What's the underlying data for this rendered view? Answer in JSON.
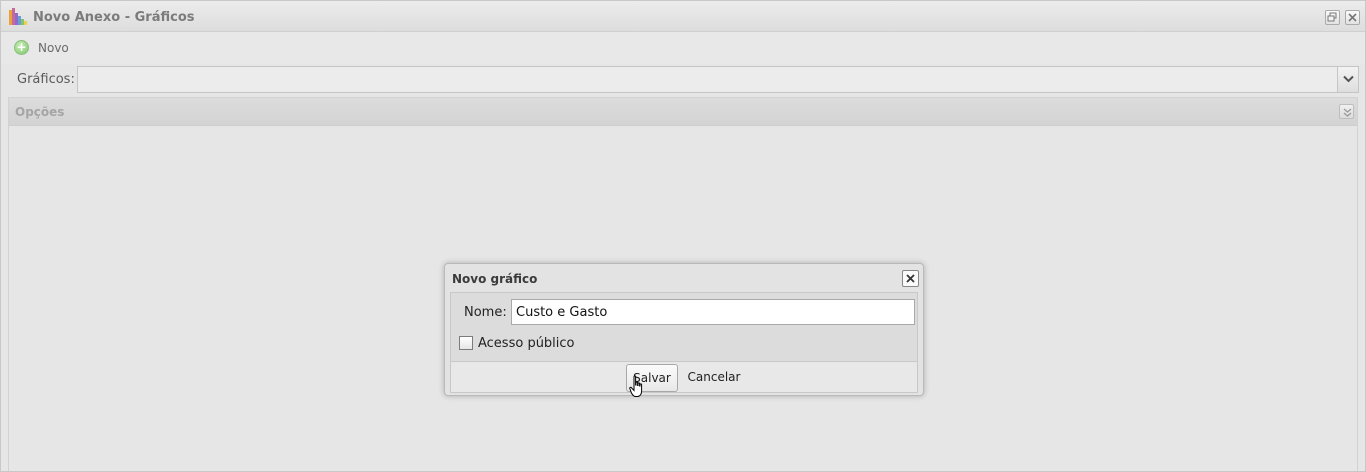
{
  "window": {
    "title": "Novo Anexo - Gráficos",
    "icons": [
      "bar-chart-icon",
      "restore-icon",
      "close-icon"
    ]
  },
  "toolbar": {
    "new_label": "Novo",
    "new_icon": "add-icon"
  },
  "graficos": {
    "label": "Gráficos:",
    "selected_value": ""
  },
  "options_panel": {
    "title": "Opções",
    "collapse_icon": "double-chevron-down-icon"
  },
  "dialog": {
    "title": "Novo gráfico",
    "name_label": "Nome:",
    "name_value": "Custo e Gasto",
    "public_label": "Acesso público",
    "public_checked": false,
    "save_label": "Salvar",
    "cancel_label": "Cancelar"
  },
  "colors": {
    "window_bg": "#e6e6e6",
    "title_text": "#7b7b7b",
    "add_icon": "#7dc46a"
  }
}
